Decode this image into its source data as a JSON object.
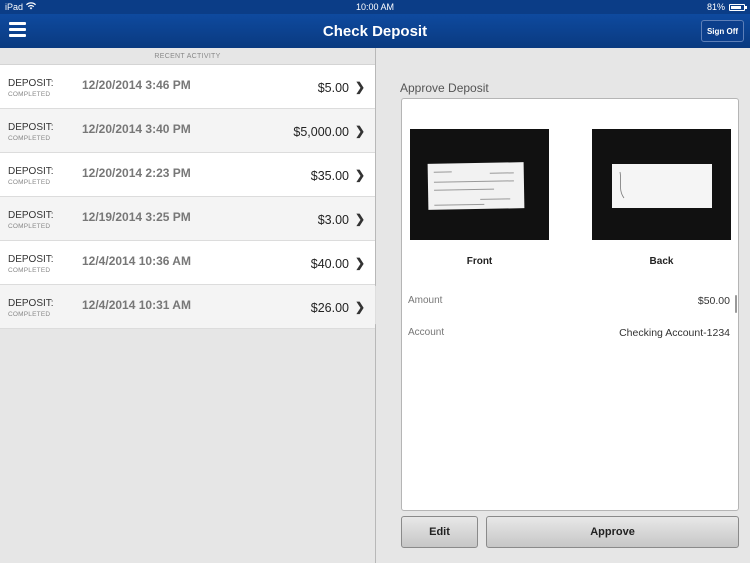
{
  "status_bar": {
    "device": "iPad",
    "time": "10:00 AM",
    "battery": "81%"
  },
  "nav": {
    "title": "Check Deposit",
    "sign_off": "Sign Off"
  },
  "recent_activity": {
    "header": "RECENT ACTIVITY",
    "items": [
      {
        "type": "DEPOSIT:",
        "status": "COMPLETED",
        "date": "12/20/2014 3:46 PM",
        "amount": "$5.00"
      },
      {
        "type": "DEPOSIT:",
        "status": "COMPLETED",
        "date": "12/20/2014 3:40 PM",
        "amount": "$5,000.00"
      },
      {
        "type": "DEPOSIT:",
        "status": "COMPLETED",
        "date": "12/20/2014 2:23 PM",
        "amount": "$35.00"
      },
      {
        "type": "DEPOSIT:",
        "status": "COMPLETED",
        "date": "12/19/2014 3:25 PM",
        "amount": "$3.00"
      },
      {
        "type": "DEPOSIT:",
        "status": "COMPLETED",
        "date": "12/4/2014 10:36 AM",
        "amount": "$40.00"
      },
      {
        "type": "DEPOSIT:",
        "status": "COMPLETED",
        "date": "12/4/2014 10:31 AM",
        "amount": "$26.00"
      }
    ]
  },
  "approve": {
    "title": "Approve Deposit",
    "front_label": "Front",
    "back_label": "Back",
    "amount_label": "Amount",
    "amount_value": "$50.00",
    "account_label": "Account",
    "account_value": "Checking Account-1234",
    "edit_button": "Edit",
    "approve_button": "Approve"
  },
  "colors": {
    "nav_bar": "#0b3d87",
    "panel_bg": "#e6e6e6"
  }
}
